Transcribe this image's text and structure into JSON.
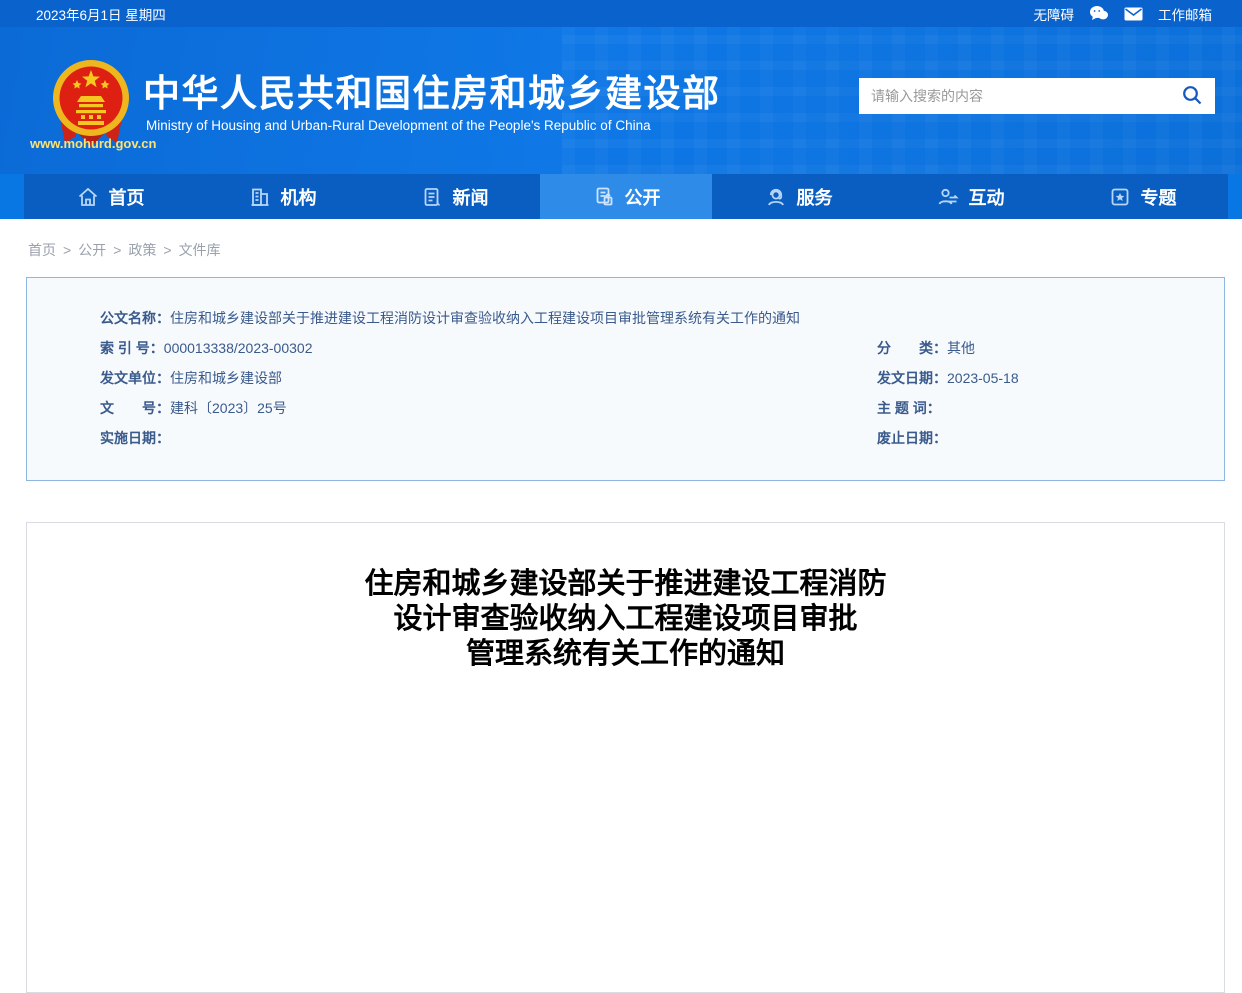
{
  "topbar": {
    "date": "2023年6月1日 星期四",
    "accessibility_label": "无障碍",
    "mailbox_label": "工作邮箱"
  },
  "header": {
    "site_title": "中华人民共和国住房和城乡建设部",
    "site_subtitle": "Ministry of Housing and Urban-Rural Development of the People's Republic of China",
    "site_url": "www.mohurd.gov.cn",
    "search_placeholder": "请输入搜索的内容"
  },
  "nav": {
    "items": [
      {
        "label": "首页",
        "icon": "home-icon",
        "active": false
      },
      {
        "label": "机构",
        "icon": "organization-icon",
        "active": false
      },
      {
        "label": "新闻",
        "icon": "news-icon",
        "active": false
      },
      {
        "label": "公开",
        "icon": "disclosure-icon",
        "active": true
      },
      {
        "label": "服务",
        "icon": "service-icon",
        "active": false
      },
      {
        "label": "互动",
        "icon": "interaction-icon",
        "active": false
      },
      {
        "label": "专题",
        "icon": "topics-icon",
        "active": false
      }
    ]
  },
  "breadcrumb": {
    "items": [
      "首页",
      "公开",
      "政策",
      "文件库"
    ],
    "separator": ">"
  },
  "meta_box": {
    "doc_name": {
      "label": "公文名称：",
      "value": "住房和城乡建设部关于推进建设工程消防设计审查验收纳入工程建设项目审批管理系统有关工作的通知"
    },
    "index_no": {
      "label": "索 引 号：",
      "value": "000013338/2023-00302"
    },
    "category": {
      "label": "分　　类：",
      "value": "其他"
    },
    "issuing_unit": {
      "label": "发文单位：",
      "value": "住房和城乡建设部"
    },
    "issue_date": {
      "label": "发文日期：",
      "value": "2023-05-18"
    },
    "doc_no": {
      "label": "文　　号：",
      "value": "建科〔2023〕25号"
    },
    "subject_words": {
      "label": "主 题 词：",
      "value": ""
    },
    "impl_date": {
      "label": "实施日期：",
      "value": ""
    },
    "repeal_date": {
      "label": "废止日期：",
      "value": ""
    }
  },
  "document": {
    "title_lines": [
      "住房和城乡建设部关于推进建设工程消防",
      "设计审查验收纳入工程建设项目审批",
      "管理系统有关工作的通知"
    ]
  },
  "icons": {
    "wechat-icon": "chat-bubbles",
    "mail-icon": "envelope",
    "search-icon": "magnifier",
    "national-emblem": "PRC national emblem"
  },
  "colors": {
    "topbar_blue": "#0a62cc",
    "header_blue": "#0f78e6",
    "nav_blue": "#0a5ec2",
    "nav_active_blue": "#2e8ce8",
    "meta_border": "#8fb5e2",
    "meta_bg": "#f7fafd",
    "meta_text": "#3a5a8c",
    "url_yellow": "#ffe26f"
  }
}
